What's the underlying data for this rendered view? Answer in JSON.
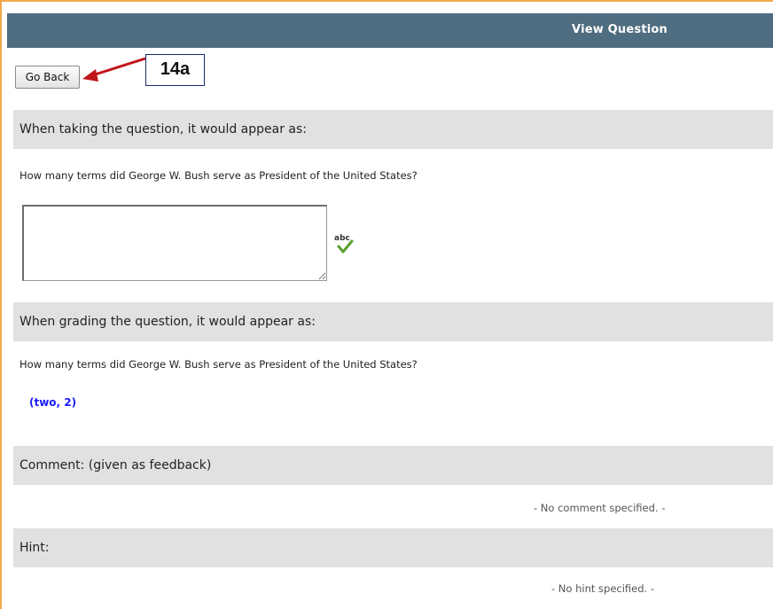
{
  "header": {
    "title": "View Question"
  },
  "toolbar": {
    "go_back_label": "Go Back"
  },
  "annotation": {
    "callout_label": "14a"
  },
  "taking_section": {
    "heading": "When taking the question, it would appear as:",
    "question_text": "How many terms did George W. Bush serve as President of the United States?",
    "answer_input_value": "",
    "spellcheck_icon": "spellcheck-icon",
    "spellcheck_text": "abc"
  },
  "grading_section": {
    "heading": "When grading the question, it would appear as:",
    "question_text": "How many terms did George W. Bush serve as President of the United States?",
    "accepted_answers": "(two, 2)"
  },
  "comment_section": {
    "heading": "Comment: (given as feedback)",
    "empty_message": "- No comment specified. -"
  },
  "hint_section": {
    "heading": "Hint:",
    "empty_message": "- No hint specified. -"
  },
  "colors": {
    "header_bg": "#4f6d80",
    "section_bg": "#e1e1e1",
    "answer_blue": "#1a1aff",
    "callout_arrow": "#c0141b",
    "frame_border": "#f0a94a"
  }
}
